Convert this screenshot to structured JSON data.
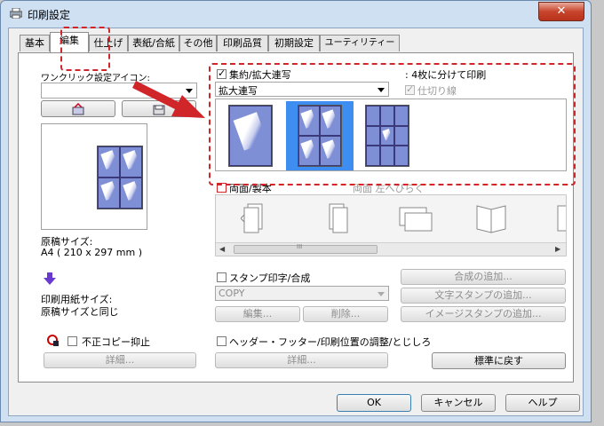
{
  "window": {
    "title": "印刷設定",
    "close_glyph": "✕"
  },
  "tabs": [
    "基本",
    "編集",
    "仕上げ",
    "表紙/合紙",
    "その他",
    "印刷品質",
    "初期設定",
    "ユーティリティー"
  ],
  "active_tab": "編集",
  "one_click": {
    "label": "ワンクリック設定アイコン:",
    "value": ""
  },
  "preview": {
    "original_size_label": "原稿サイズ:",
    "original_size_value": "A4 ( 210 x 297 mm )",
    "paper_size_label": "印刷用紙サイズ:",
    "paper_size_value": "原稿サイズと同じ"
  },
  "nup": {
    "checkbox_label": "集約/拡大連写",
    "checked": true,
    "mode_value": "拡大連写",
    "info_text": ": 4枚に分けて印刷",
    "divider_label": "仕切り線",
    "divider_checked": true
  },
  "duplex": {
    "checkbox_label": "両面/製本",
    "checked": false,
    "direction_label": "両面 左へひらく",
    "scroll_glyph": "III"
  },
  "stamp": {
    "checkbox_label": "スタンプ印字/合成",
    "checked": false,
    "combo_value": "COPY",
    "edit_button": "編集...",
    "delete_button": "削除...",
    "add_overlay_button": "合成の追加...",
    "add_text_stamp_button": "文字スタンプの追加...",
    "add_image_stamp_button": "イメージスタンプの追加..."
  },
  "copy_guard": {
    "checkbox_label": "不正コピー抑止",
    "checked": false,
    "detail_button": "詳細..."
  },
  "header_footer": {
    "checkbox_label": "ヘッダー・フッター/印刷位置の調整/とじしろ",
    "checked": false,
    "detail_button": "詳細..."
  },
  "reset_button": "標準に戻す",
  "footer": {
    "ok": "OK",
    "cancel": "キャンセル",
    "help": "ヘルプ"
  },
  "colors": {
    "highlight": "#d0262a",
    "selection": "#3d8ef0",
    "arrow": "#d0262a"
  }
}
